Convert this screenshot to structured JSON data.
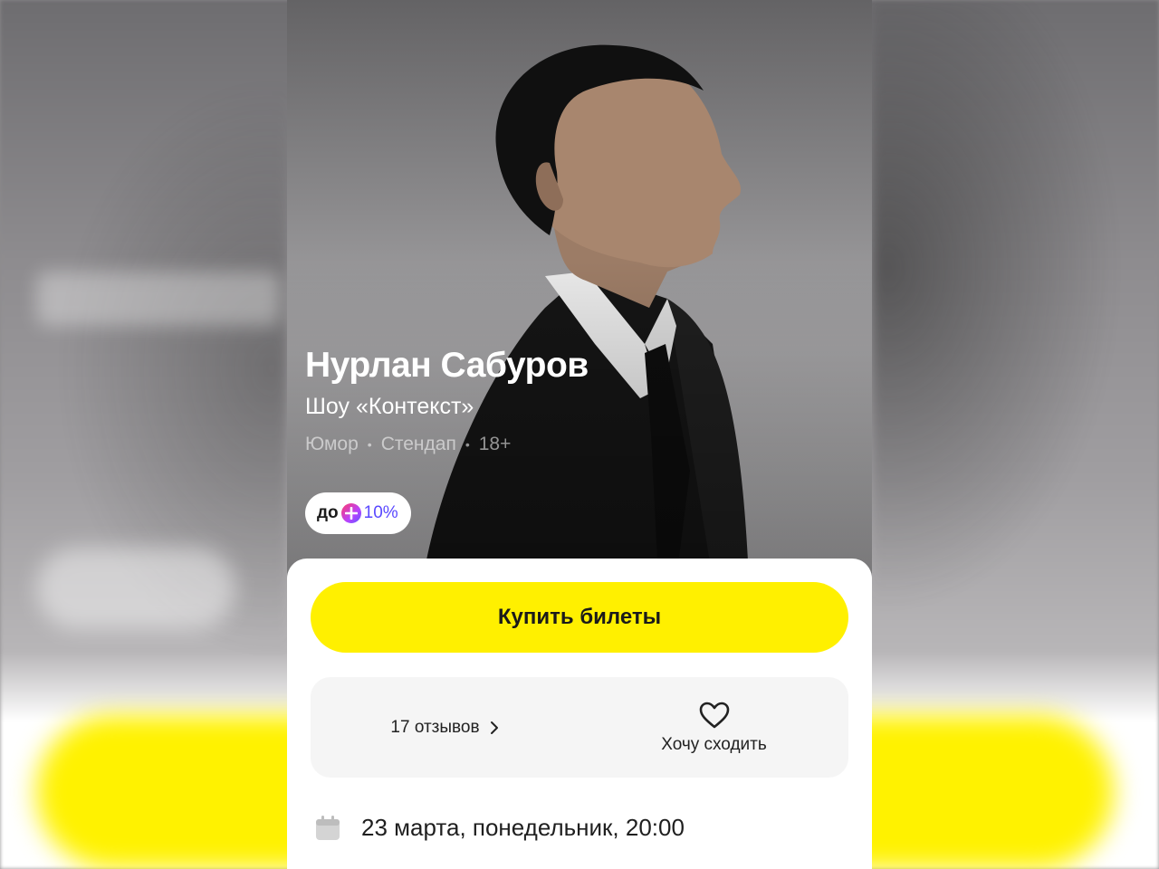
{
  "event": {
    "artist": "Нурлан Сабуров",
    "show": "Шоу «Контекст»",
    "tags": [
      "Юмор",
      "Стендап",
      "18+"
    ],
    "cashback": {
      "prefix": "до",
      "value": "10%"
    }
  },
  "actions": {
    "buy_label": "Купить билеты",
    "reviews_label": "17 отзывов",
    "want_go_label": "Хочу сходить"
  },
  "schedule": {
    "date_label": "23 марта, понедельник, 20:00"
  },
  "colors": {
    "accent_yellow": "#fff000",
    "plus_purple": "#5a49ff",
    "card_bg": "#f5f5f5"
  },
  "icons": [
    "plus-icon",
    "chevron-right-icon",
    "heart-icon",
    "calendar-icon"
  ]
}
